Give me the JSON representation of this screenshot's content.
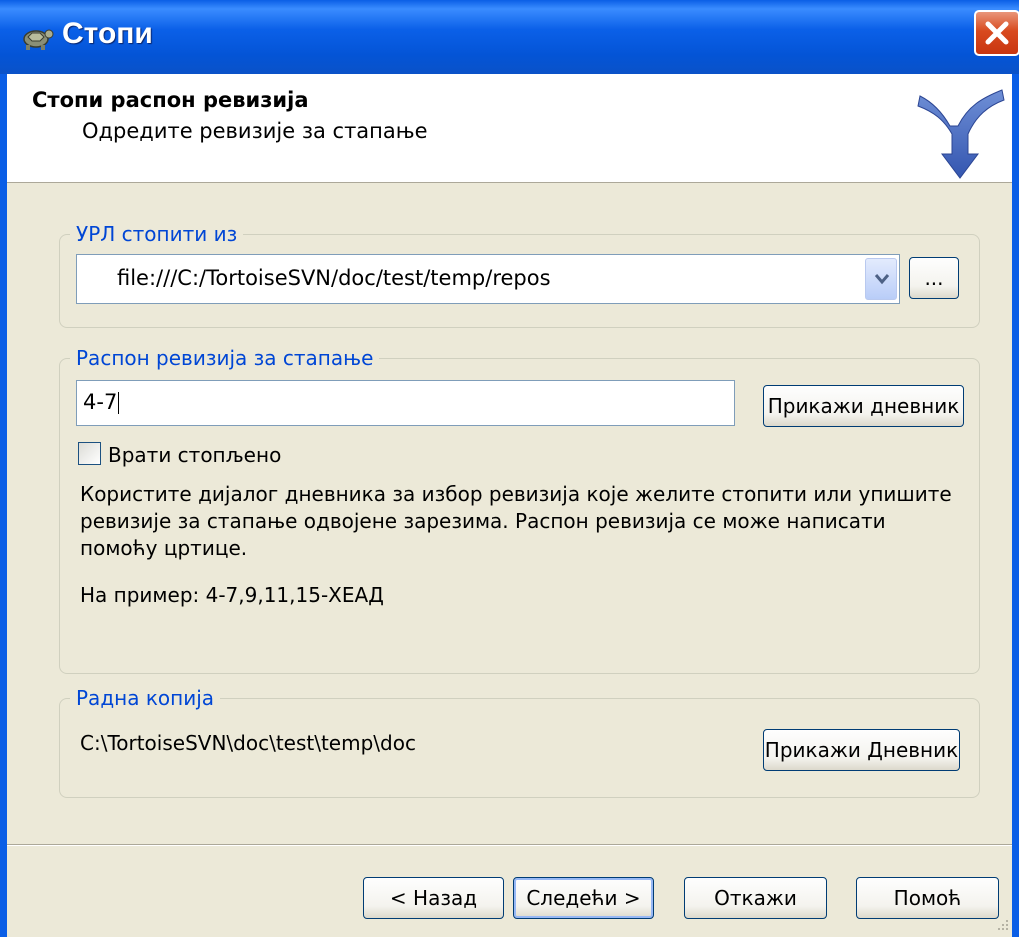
{
  "window": {
    "title": "Стопи",
    "accent": "#0a5ee6"
  },
  "header": {
    "title": "Стопи распон ревизија",
    "subtitle": "Одредите ревизије за стапање",
    "logo_icon": "tortoisesvn-merge-icon"
  },
  "url_group": {
    "legend": "УРЛ стопити из",
    "url_value": "file:///C:/TortoiseSVN/doc/test/temp/repos",
    "browse_label": "..."
  },
  "range_group": {
    "legend": "Распон ревизија за стапање",
    "range_value": "4-7",
    "show_log_label": "Прикажи дневник",
    "reverse_label": "Врати стопљено",
    "reverse_checked": false,
    "description": "Користите дијалог дневника за избор ревизија које желите стопити или упишите ревизије за стапање одвојене зарезима. Распон ревизија се може написати помоћу цртице.",
    "example": "На пример: 4-7,9,11,15-ХЕАД"
  },
  "wc_group": {
    "legend": "Радна копија",
    "path": "C:\\TortoiseSVN\\doc\\test\\temp\\doc",
    "show_log_label": "Прикажи Дневник"
  },
  "footer": {
    "back_label": "< Назад",
    "next_label": "Следећи >",
    "cancel_label": "Откажи",
    "help_label": "Помоћ"
  }
}
